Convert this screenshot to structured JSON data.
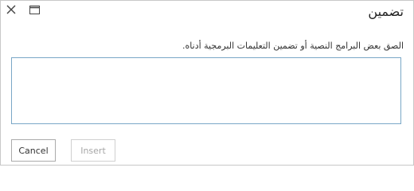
{
  "dialog": {
    "title": "تضمين",
    "instruction": "الصق بعض البرامج النصية أو تضمين التعليمات البرمجية أدناه.",
    "code_input": {
      "value": "",
      "placeholder": ""
    },
    "close_icon": "close-icon",
    "maximize_icon": "maximize-icon"
  },
  "buttons": {
    "cancel_label": "Cancel",
    "insert_label": "Insert",
    "insert_disabled": true
  },
  "colors": {
    "input_border": "#7aa7c7",
    "disabled_text": "#a6a6a6"
  }
}
